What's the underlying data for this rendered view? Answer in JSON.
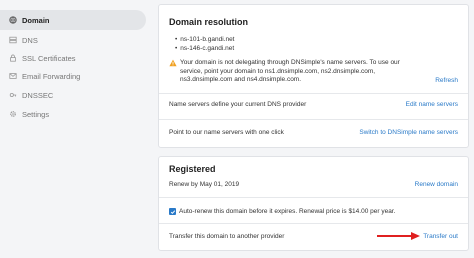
{
  "sidebar": {
    "items": [
      {
        "label": "Domain",
        "icon": "globe-icon",
        "active": true
      },
      {
        "label": "DNS",
        "icon": "dns-icon",
        "active": false
      },
      {
        "label": "SSL Certificates",
        "icon": "lock-icon",
        "active": false
      },
      {
        "label": "Email Forwarding",
        "icon": "mail-icon",
        "active": false
      },
      {
        "label": "DNSSEC",
        "icon": "key-icon",
        "active": false
      },
      {
        "label": "Settings",
        "icon": "gear-icon",
        "active": false
      }
    ]
  },
  "resolution": {
    "title": "Domain resolution",
    "nameservers": [
      "ns-101-b.gandi.net",
      "ns-146-c.gandi.net"
    ],
    "warning": "Your domain is not delegating through DNSimple's name servers. To use our service, point your domain to ns1.dnsimple.com, ns2.dnsimple.com, ns3.dnsimple.com and ns4.dnsimple.com.",
    "refresh_label": "Refresh",
    "ns_row_text": "Name servers define your current DNS provider",
    "edit_ns_label": "Edit name servers",
    "point_row_text": "Point to our name servers with one click",
    "switch_label": "Switch to DNSimple name servers"
  },
  "registered": {
    "title": "Registered",
    "renew_text": "Renew by May 01, 2019",
    "renew_label": "Renew domain",
    "autorenew_text": "Auto-renew this domain before it expires. Renewal price is $14.00 per year.",
    "autorenew_checked": true,
    "transfer_text": "Transfer this domain to another provider",
    "transfer_label": "Transfer out"
  },
  "colors": {
    "link": "#2a7ac8",
    "warning": "#f0a020",
    "arrow": "#e02020"
  }
}
